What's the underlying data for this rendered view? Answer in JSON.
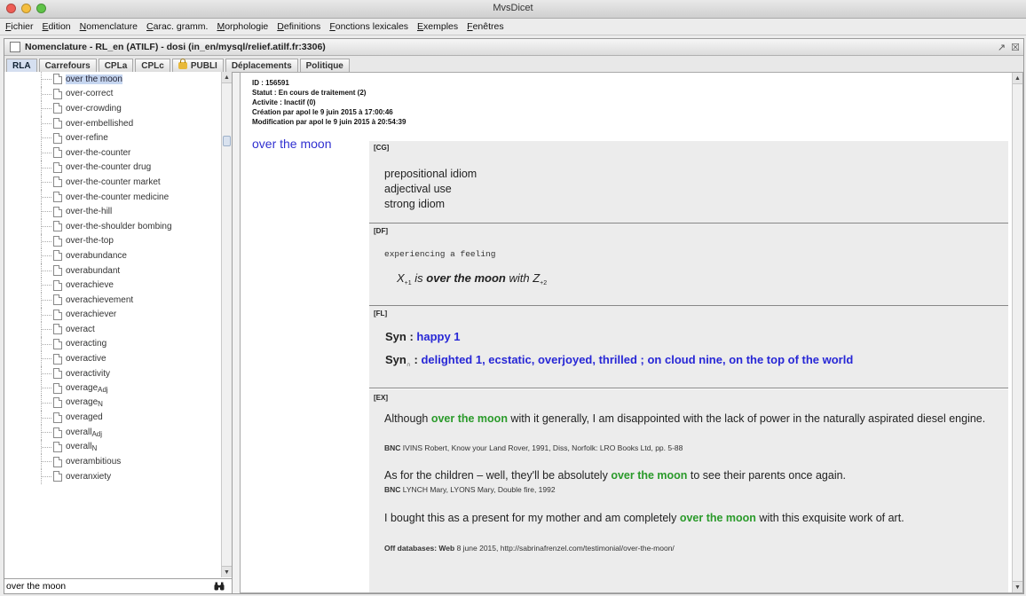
{
  "window": {
    "title": "MvsDicet",
    "light_colors": [
      "#ee5d55",
      "#f5be3e",
      "#5fc348"
    ]
  },
  "menu": [
    "Fichier",
    "Edition",
    "Nomenclature",
    "Carac. gramm.",
    "Morphologie",
    "Definitions",
    "Fonctions lexicales",
    "Exemples",
    "Fenêtres"
  ],
  "panel": {
    "title": "Nomenclature - RL_en (ATILF) - dosi (in_en/mysql/relief.atilf.fr:3306)"
  },
  "tabs": [
    "RLA",
    "Carrefours",
    "CPLa",
    "CPLc",
    "PUBLI",
    "Déplacements",
    "Politique"
  ],
  "tree": [
    {
      "label": "over the moon",
      "selected": true
    },
    {
      "label": "over-correct"
    },
    {
      "label": "over-crowding"
    },
    {
      "label": "over-embellished"
    },
    {
      "label": "over-refine"
    },
    {
      "label": "over-the-counter"
    },
    {
      "label": "over-the-counter drug"
    },
    {
      "label": "over-the-counter market"
    },
    {
      "label": "over-the-counter medicine"
    },
    {
      "label": "over-the-hill"
    },
    {
      "label": "over-the-shoulder bombing"
    },
    {
      "label": "over-the-top"
    },
    {
      "label": "overabundance"
    },
    {
      "label": "overabundant"
    },
    {
      "label": "overachieve"
    },
    {
      "label": "overachievement"
    },
    {
      "label": "overachiever"
    },
    {
      "label": "overact"
    },
    {
      "label": "overacting"
    },
    {
      "label": "overactive"
    },
    {
      "label": "overactivity"
    },
    {
      "label": "overage",
      "sub": "Adj"
    },
    {
      "label": "overage",
      "sub": "N"
    },
    {
      "label": "overaged"
    },
    {
      "label": "overall",
      "sub": "Adj"
    },
    {
      "label": "overall",
      "sub": "N"
    },
    {
      "label": "overambitious"
    },
    {
      "label": "overanxiety"
    }
  ],
  "search": {
    "value": "over the moon"
  },
  "entry": {
    "meta": [
      "ID : 156591",
      "Statut : En cours de traitement (2)",
      "Activite : Inactif (0)",
      "Création par apol le 9 juin 2015 à 17:00:46",
      "Modification par apol le 9 juin 2015 à 20:54:39"
    ],
    "headword": "over the moon",
    "cg": {
      "label": "[CG]",
      "lines": [
        "prepositional idiom",
        "adjectival use",
        "strong idiom"
      ]
    },
    "df": {
      "label": "[DF]",
      "gloss": "experiencing a feeling",
      "formula_x": "X",
      "formula_x_sub": "+1",
      "formula_mid": " is ",
      "formula_bold": "over the moon",
      "formula_with": " with Z",
      "formula_z_sub": "+2"
    },
    "fl": {
      "label": "[FL]",
      "syn1_name": "Syn",
      "syn1_values": "happy 1",
      "syn2_name": "Syn",
      "syn2_sub": "∩",
      "syn2_values": "delighted 1, ecstatic, overjoyed, thrilled ; on cloud nine, on the top of the world"
    },
    "ex": {
      "label": "[EX]",
      "examples": [
        {
          "before": "Although ",
          "highlight": "over the moon",
          "after": " with it generally, I am disappointed with the lack of power in the naturally aspirated diesel engine.",
          "source_bold": "BNC",
          "source": " IVINS Robert, Know your Land Rover, 1991, Diss, Norfolk: LRO Books Ltd, pp. 5-88"
        },
        {
          "before": "As for the children – well, they'll be absolutely ",
          "highlight": "over the moon",
          "after": " to see their parents once again.",
          "source_bold": "BNC",
          "source": " LYNCH Mary, LYONS Mary, Double fire, 1992"
        },
        {
          "before": "I bought this as a present for my mother and am completely ",
          "highlight": "over the moon",
          "after": " with this exquisite work of art.",
          "source_bold": "Off databases: Web",
          "source": " 8 june 2015, http://sabrinafrenzel.com/testimonial/over-the-moon/"
        }
      ]
    }
  }
}
